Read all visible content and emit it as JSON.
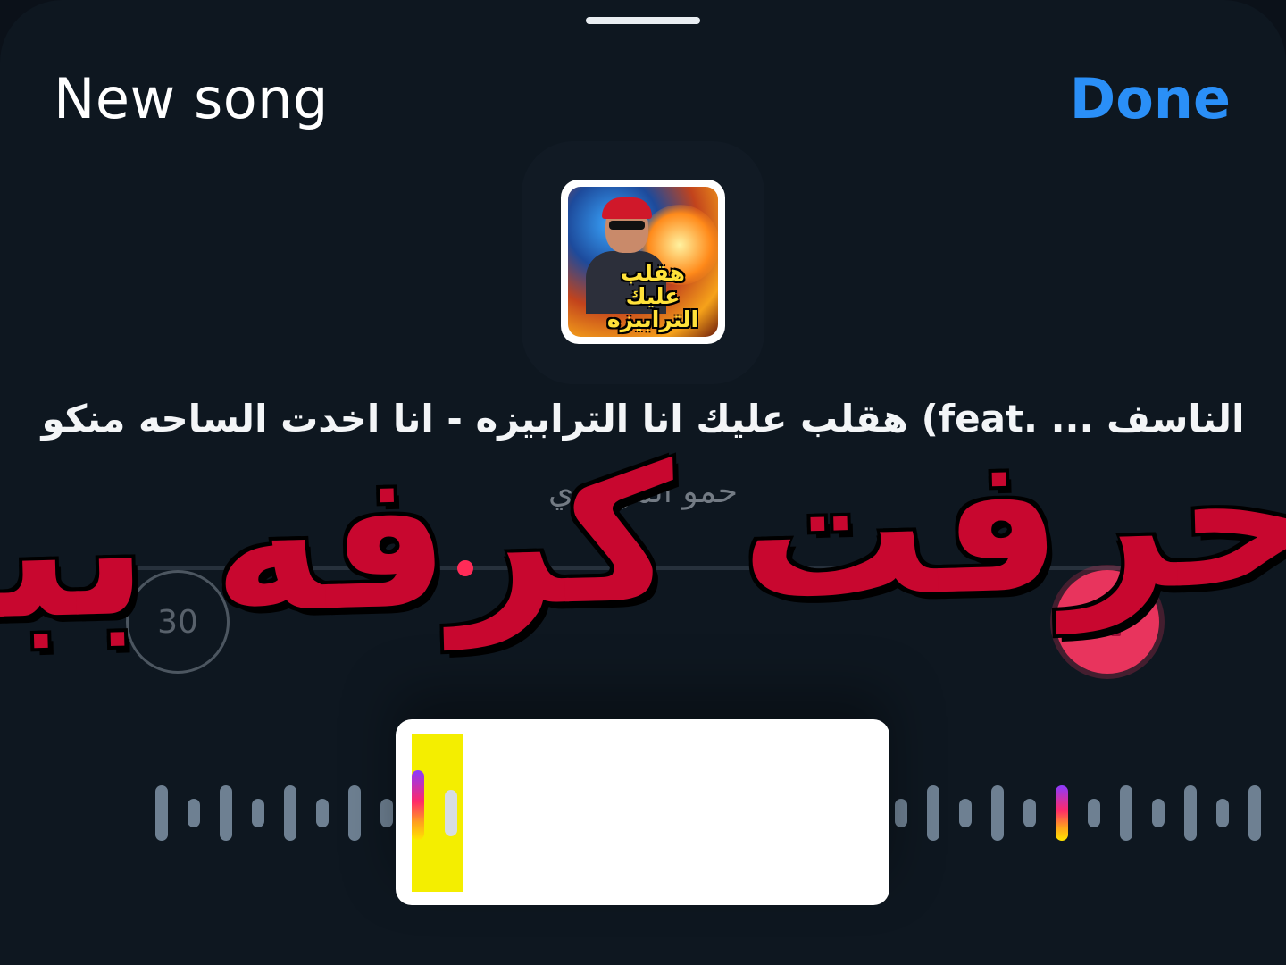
{
  "header": {
    "title": "New song",
    "done_label": "Done"
  },
  "song": {
    "title": "الناسف ... .feat) هقلب عليك انا الترابيزه - انا اخدت الساحه منكو",
    "artist": "حمو المرشدي",
    "cover_text": "هقلب عليك الترابيزه"
  },
  "player": {
    "duration_label": "30",
    "progress": 0.32,
    "state": "paused"
  },
  "overlay": {
    "caption": "حرفت كرفه ببريز"
  },
  "colors": {
    "accent": "#2a8ff7",
    "play": "#e8345d",
    "overlay_text": "#c8072f",
    "selector_handle": "#f4ee00"
  },
  "icons": {
    "play_button": "pause-icon",
    "duration_button": "timer-30-icon"
  }
}
